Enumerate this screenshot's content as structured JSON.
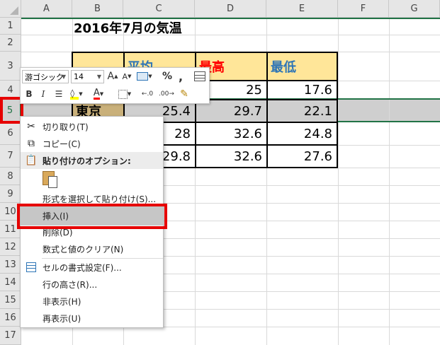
{
  "columns": [
    "A",
    "B",
    "C",
    "D",
    "E",
    "F",
    "G"
  ],
  "rows": [
    "1",
    "2",
    "3",
    "4",
    "5",
    "6",
    "7",
    "8",
    "9",
    "10",
    "11",
    "12",
    "13",
    "14",
    "15",
    "16",
    "17"
  ],
  "sheet": {
    "title": "2016年7月の気温",
    "header": {
      "avg": "平均",
      "high": "最高",
      "low": "最低"
    },
    "row5": {
      "city": "東京",
      "avg": "25.4",
      "high": "29.7",
      "low": "22.1"
    },
    "cells": {
      "d4": "25",
      "e4": "17.6",
      "c6": "28",
      "d6": "32.6",
      "e6": "24.8",
      "c7": "29.8",
      "d7": "32.6",
      "e7": "27.6"
    }
  },
  "mini_toolbar": {
    "font_name": "游ゴシック",
    "font_size": "14",
    "grow": "A",
    "shrink": "A",
    "percent": "%",
    "comma": ",",
    "bold": "B",
    "italic": "I",
    "font_color_letter": "A",
    "dec_more": ".00",
    "dec_less": ".0"
  },
  "context_menu": {
    "cut": "切り取り(T)",
    "copy": "コピー(C)",
    "paste_options": "貼り付けのオプション:",
    "paste_special": "形式を選択して貼り付け(S)...",
    "insert": "挿入(I)",
    "delete": "削除(D)",
    "clear": "数式と値のクリア(N)",
    "format_cells": "セルの書式設定(F)...",
    "row_height": "行の高さ(R)...",
    "hide": "非表示(H)",
    "unhide": "再表示(U)"
  },
  "colors": {
    "header_fill": "#ffe699",
    "high_text": "#ff0000",
    "low_text": "#2e75b6",
    "city_fill": "#c9b07a",
    "excel_green": "#217346",
    "highlight_red": "#e60000"
  }
}
